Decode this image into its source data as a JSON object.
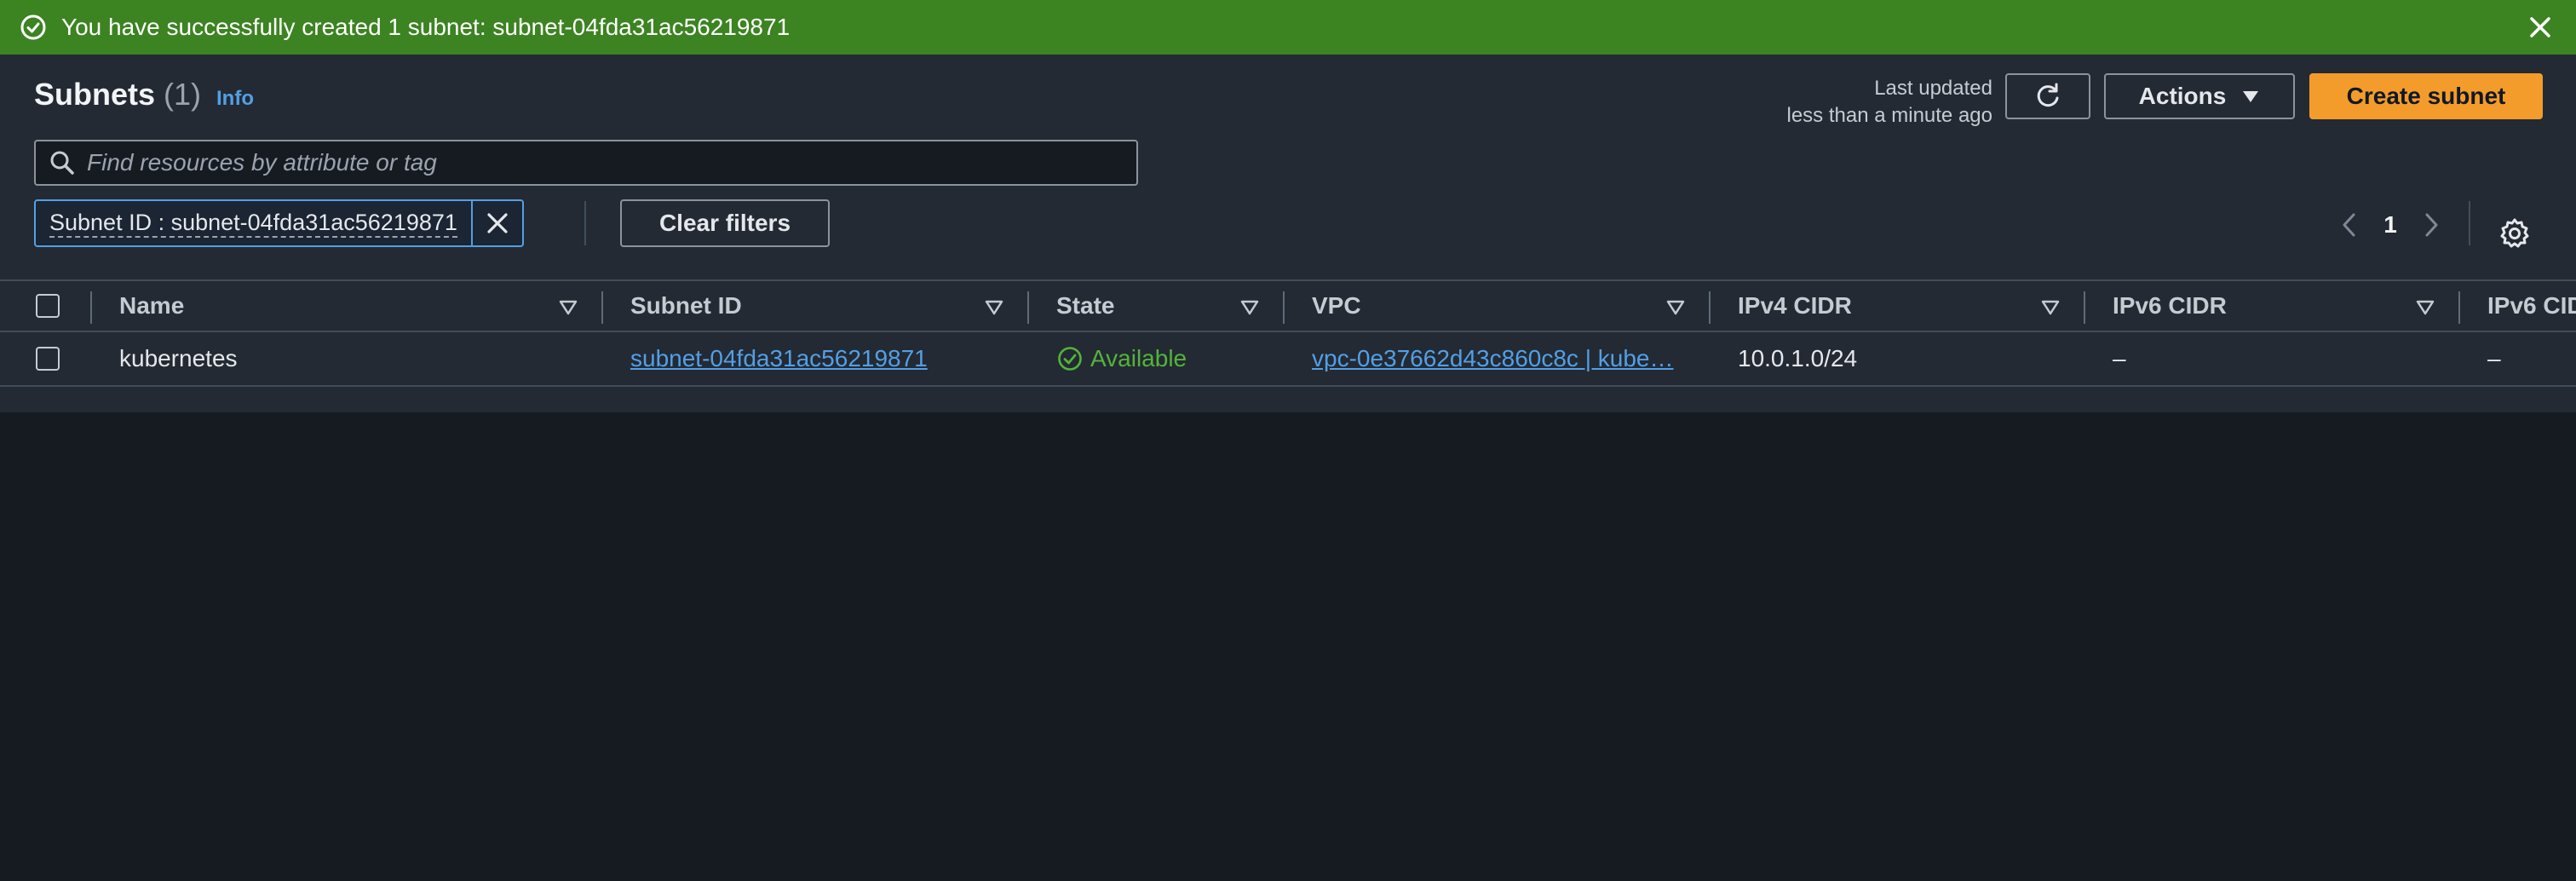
{
  "flash": {
    "message": "You have successfully created 1 subnet: subnet-04fda31ac56219871",
    "icon": "success-check-icon",
    "close_icon": "close-icon",
    "color": "#3c8321"
  },
  "header": {
    "title": "Subnets",
    "count": "(1)",
    "info_label": "Info",
    "last_updated_line1": "Last updated",
    "last_updated_line2": "less than a minute ago",
    "actions_label": "Actions",
    "create_label": "Create subnet",
    "accent_color": "#f39c2b"
  },
  "search": {
    "placeholder": "Find resources by attribute or tag",
    "value": ""
  },
  "filter": {
    "token_label": "Subnet ID : subnet-04fda31ac56219871",
    "clear_label": "Clear filters"
  },
  "pagination": {
    "current_page": "1"
  },
  "table": {
    "columns": [
      "Name",
      "Subnet ID",
      "State",
      "VPC",
      "IPv4 CIDR",
      "IPv6 CIDR",
      "IPv6 CID"
    ],
    "rows": [
      {
        "name": "kubernetes",
        "subnet_id": "subnet-04fda31ac56219871",
        "state": "Available",
        "vpc": "vpc-0e37662d43c860c8c | kube…",
        "ipv4_cidr": "10.0.1.0/24",
        "ipv6_cidr": "–",
        "ipv6_cid": "–"
      }
    ]
  }
}
